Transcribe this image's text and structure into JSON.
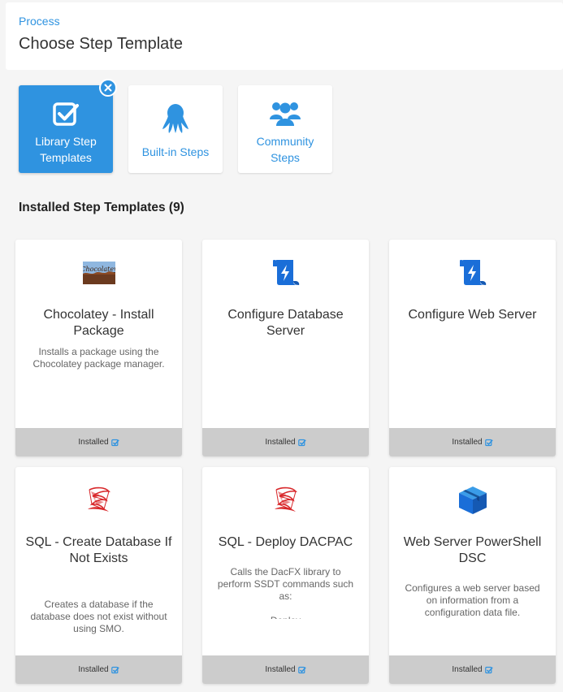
{
  "header": {
    "breadcrumb": "Process",
    "title": "Choose Step Template"
  },
  "categories": [
    {
      "label_line1": "Library Step",
      "label_line2": "Templates",
      "icon": "checkbox-icon",
      "active": true
    },
    {
      "label_line1": "Built-in Steps",
      "label_line2": "",
      "icon": "octopus-icon",
      "active": false
    },
    {
      "label_line1": "Community",
      "label_line2": "Steps",
      "icon": "users-icon",
      "active": false
    }
  ],
  "section": {
    "title": "Installed Step Templates (9)"
  },
  "templates": [
    {
      "title": "Chocolatey - Install Package",
      "description": "Installs a package using the Chocolatey package manager.",
      "status": "Installed",
      "icon": "chocolatey-logo"
    },
    {
      "title": "Configure Database Server",
      "description": "",
      "status": "Installed",
      "icon": "script-icon"
    },
    {
      "title": "Configure Web Server",
      "description": "",
      "status": "Installed",
      "icon": "script-icon"
    },
    {
      "title": "SQL - Create Database If Not Exists",
      "description": "Creates a database if the database does not exist without using SMO.",
      "status": "Installed",
      "icon": "sql-server-icon"
    },
    {
      "title": "SQL - Deploy DACPAC",
      "description": "Calls the DacFX library to perform SSDT commands such as:\n\nDeploy",
      "status": "Installed",
      "icon": "sql-server-icon"
    },
    {
      "title": "Web Server PowerShell DSC",
      "description": "Configures a web server based on information from a configuration data file.",
      "status": "Installed",
      "icon": "package-icon"
    }
  ],
  "colors": {
    "accent": "#2f93e0",
    "footer": "#cccccc",
    "sql_red": "#d8272a"
  }
}
